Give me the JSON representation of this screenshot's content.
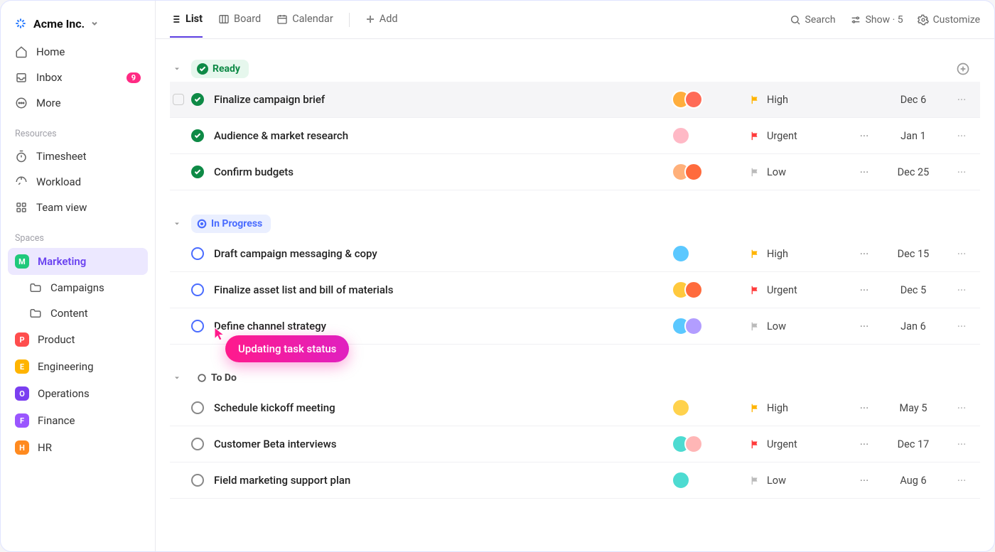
{
  "workspace": {
    "name": "Acme Inc."
  },
  "sidebar": {
    "nav": [
      {
        "icon": "home-icon",
        "label": "Home"
      },
      {
        "icon": "inbox-icon",
        "label": "Inbox",
        "badge": "9"
      },
      {
        "icon": "more-icon",
        "label": "More"
      }
    ],
    "sections": {
      "resources": {
        "label": "Resources",
        "items": [
          {
            "icon": "timer-icon",
            "label": "Timesheet"
          },
          {
            "icon": "gauge-icon",
            "label": "Workload"
          },
          {
            "icon": "grid-icon",
            "label": "Team view"
          }
        ]
      },
      "spaces": {
        "label": "Spaces",
        "items": [
          {
            "badge": "M",
            "color": "#1fc97b",
            "label": "Marketing",
            "active": true,
            "children": [
              {
                "icon": "folder-icon",
                "label": "Campaigns"
              },
              {
                "icon": "folder-icon",
                "label": "Content"
              }
            ]
          },
          {
            "badge": "P",
            "color": "#ff4d4d",
            "label": "Product"
          },
          {
            "badge": "E",
            "color": "#ffb400",
            "label": "Engineering"
          },
          {
            "badge": "O",
            "color": "#7a3ff0",
            "label": "Operations"
          },
          {
            "badge": "F",
            "color": "#9a56ff",
            "label": "Finance"
          },
          {
            "badge": "H",
            "color": "#ff8a1f",
            "label": "HR"
          }
        ]
      }
    }
  },
  "topbar": {
    "tabs": [
      {
        "icon": "list-icon",
        "label": "List",
        "active": true
      },
      {
        "icon": "board-icon",
        "label": "Board"
      },
      {
        "icon": "calendar-icon",
        "label": "Calendar"
      }
    ],
    "add_label": "Add",
    "right": [
      {
        "icon": "search-icon",
        "label": "Search"
      },
      {
        "icon": "sliders-icon",
        "label": "Show · 5"
      },
      {
        "icon": "gear-icon",
        "label": "Customize"
      }
    ]
  },
  "groups": [
    {
      "name": "Ready",
      "style": "ready",
      "tasks": [
        {
          "title": "Finalize campaign brief",
          "assignees": [
            "#ffae3d",
            "#ff6b57"
          ],
          "priority": "High",
          "flag": "#ffb400",
          "date": "Dec 6",
          "subtasks": false,
          "highlighted": true
        },
        {
          "title": "Audience & market research",
          "assignees": [
            "#ffb9c6"
          ],
          "priority": "Urgent",
          "flag": "#ff3b3b",
          "date": "Jan 1",
          "subtasks": true
        },
        {
          "title": "Confirm budgets",
          "assignees": [
            "#ffb07a",
            "#ff6b3d"
          ],
          "priority": "Low",
          "flag": "#bbb",
          "date": "Dec 25",
          "subtasks": true
        }
      ]
    },
    {
      "name": "In Progress",
      "style": "progress",
      "tasks": [
        {
          "title": "Draft campaign messaging & copy",
          "assignees": [
            "#5bc8ff"
          ],
          "priority": "High",
          "flag": "#ffb400",
          "date": "Dec 15",
          "subtasks": true
        },
        {
          "title": "Finalize asset list and bill of materials",
          "assignees": [
            "#ffc93d",
            "#ff6b3d"
          ],
          "priority": "Urgent",
          "flag": "#ff3b3b",
          "date": "Dec 5",
          "subtasks": true
        },
        {
          "title": "Define channel strategy",
          "assignees": [
            "#5bc8ff",
            "#b29dff"
          ],
          "priority": "Low",
          "flag": "#bbb",
          "date": "Jan 6",
          "subtasks": true
        }
      ]
    },
    {
      "name": "To Do",
      "style": "todo",
      "tasks": [
        {
          "title": "Schedule kickoff meeting",
          "assignees": [
            "#ffd24d"
          ],
          "priority": "High",
          "flag": "#ffb400",
          "date": "May 5",
          "subtasks": true
        },
        {
          "title": "Customer Beta interviews",
          "assignees": [
            "#4ddbd1",
            "#ffb6b6"
          ],
          "priority": "Urgent",
          "flag": "#ff3b3b",
          "date": "Dec 17",
          "subtasks": true
        },
        {
          "title": "Field marketing support plan",
          "assignees": [
            "#4ddbd1"
          ],
          "priority": "Low",
          "flag": "#bbb",
          "date": "Aug 6",
          "subtasks": true
        }
      ]
    }
  ],
  "tooltip": {
    "text": "Updating task status"
  }
}
